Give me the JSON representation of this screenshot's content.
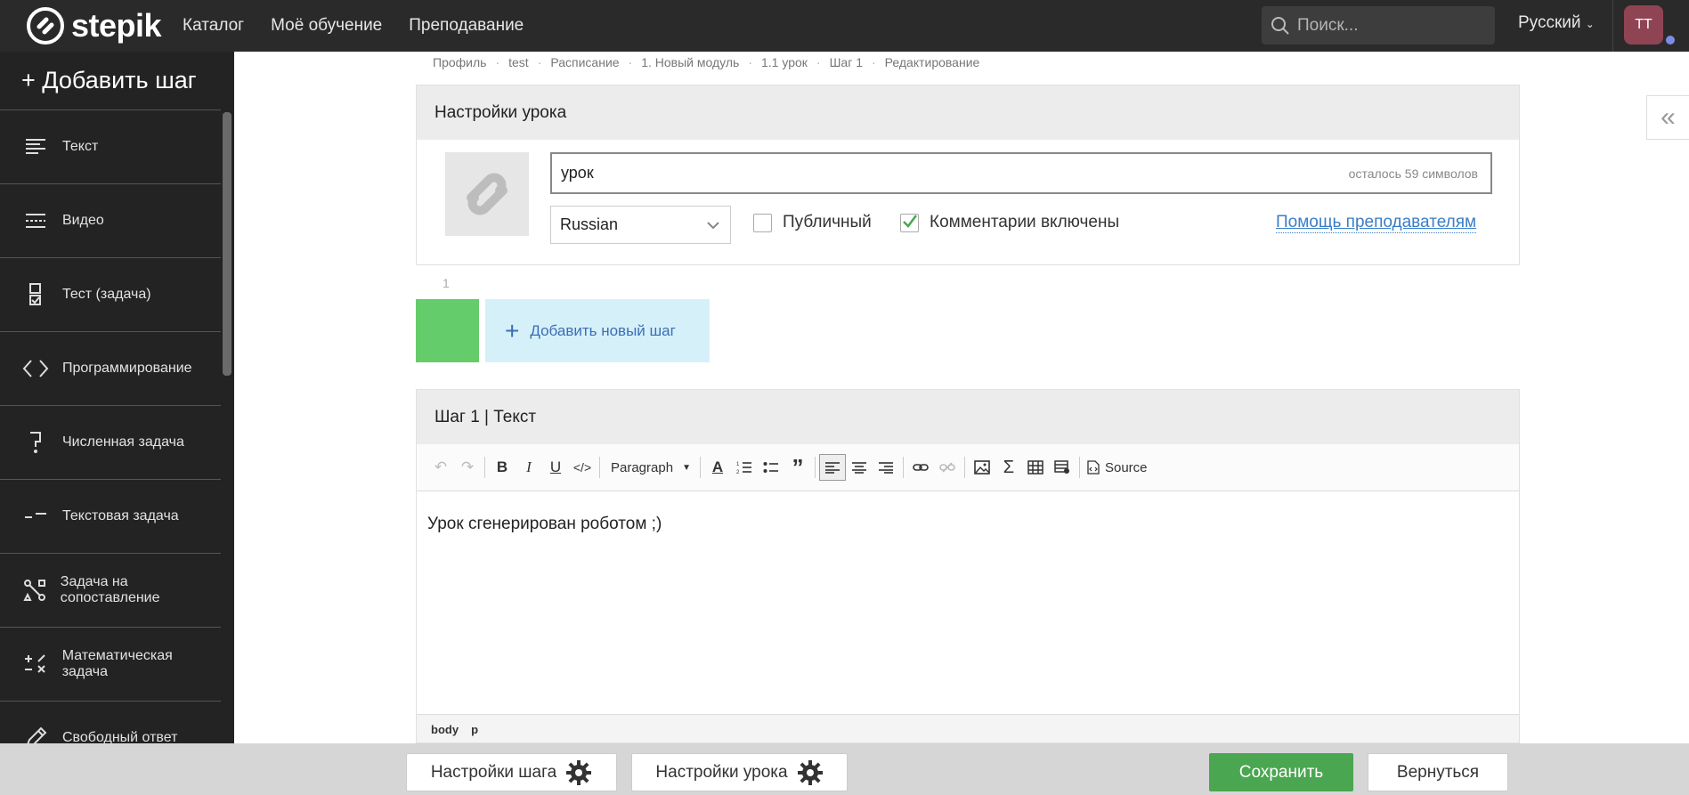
{
  "header": {
    "logo_text": "stepik",
    "nav": [
      "Каталог",
      "Моё обучение",
      "Преподавание"
    ],
    "search_placeholder": "Поиск...",
    "language": "Русский",
    "avatar_initials": "TT"
  },
  "sidebar": {
    "add_step_label": "+ Добавить шаг",
    "items": [
      {
        "label": "Текст",
        "icon": "text-lines-icon"
      },
      {
        "label": "Видео",
        "icon": "video-icon"
      },
      {
        "label": "Тест (задача)",
        "icon": "quiz-icon"
      },
      {
        "label": "Программирование",
        "icon": "code-icon"
      },
      {
        "label": "Численная задача",
        "icon": "numeric-icon"
      },
      {
        "label": "Текстовая задача",
        "icon": "text-task-icon"
      },
      {
        "label": "Задача на сопоставление",
        "icon": "matching-icon"
      },
      {
        "label": "Математическая задача",
        "icon": "math-icon"
      },
      {
        "label": "Свободный ответ",
        "icon": "pencil-icon"
      }
    ]
  },
  "breadcrumb": [
    "Профиль",
    "test",
    "Расписание",
    "1. Новый модуль",
    "1.1 урок",
    "Шаг 1",
    "Редактирование"
  ],
  "lesson_settings": {
    "title": "Настройки урока",
    "lesson_name": "урок",
    "remaining": "осталось 59 символов",
    "language": "Russian",
    "public_label": "Публичный",
    "public_checked": false,
    "comments_label": "Комментарии включены",
    "comments_checked": true,
    "help_link": "Помощь преподавателям"
  },
  "steps": {
    "number": "1",
    "add_new_label": "Добавить новый шаг"
  },
  "step_editor": {
    "title": "Шаг 1 | Текст",
    "paragraph_format": "Paragraph",
    "source_label": "Source",
    "content": "Урок сгенерирован роботом ;)",
    "status_path": [
      "body",
      "p"
    ]
  },
  "bottom": {
    "step_settings": "Настройки шага",
    "lesson_settings": "Настройки урока",
    "save": "Сохранить",
    "back": "Вернуться"
  },
  "colors": {
    "topbar": "#2a2a2a",
    "sidebar": "#232323",
    "accent_green": "#4aa650",
    "step_tile": "#64cc6a",
    "link_blue": "#3a7ec6"
  }
}
